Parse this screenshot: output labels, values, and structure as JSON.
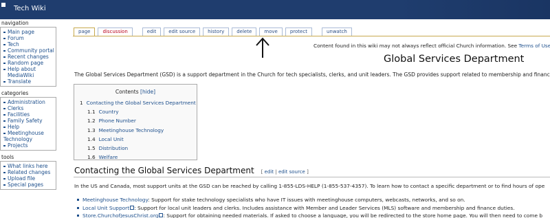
{
  "header": {
    "title": "Tech Wiki"
  },
  "sidebar": {
    "navigation": {
      "title": "navigation",
      "items": [
        "Main page",
        "Forum",
        "Tech",
        "Community portal",
        "Recent changes",
        "Random page",
        "Help about",
        "MediaWiki",
        "Translate"
      ]
    },
    "categories": {
      "title": "categories",
      "items": [
        "Administration",
        "Clerks",
        "Facilities",
        "Family Safety",
        "Help",
        "Meetinghouse",
        "Technology",
        "Projects"
      ]
    },
    "tools": {
      "title": "tools",
      "items": [
        "What links here",
        "Related changes",
        "Upload file",
        "Special pages"
      ]
    }
  },
  "tabs": [
    "page",
    "discussion",
    "edit",
    "edit source",
    "history",
    "delete",
    "move",
    "protect",
    "unwatch"
  ],
  "notice": {
    "text": "Content found in this wiki may not always reflect official Church information. See ",
    "link": "Terms of Use fo"
  },
  "page_title": "Global Services Department",
  "intro": "The Global Services Department (GSD) is a support department in the Church for tech specialists, clerks, and unit leaders. The GSD provides support related to membership and financ",
  "toc": {
    "title": "Contents",
    "hide": "[hide]",
    "items": [
      {
        "num": "1",
        "label": "Contacting the Global Services Department"
      },
      {
        "num": "1.1",
        "label": "Country"
      },
      {
        "num": "1.2",
        "label": "Phone Number"
      },
      {
        "num": "1.3",
        "label": "Meetinghouse Technology"
      },
      {
        "num": "1.4",
        "label": "Local Unit"
      },
      {
        "num": "1.5",
        "label": "Distribution"
      },
      {
        "num": "1.6",
        "label": "Welfare"
      }
    ]
  },
  "section": {
    "heading": "Contacting the Global Services Department",
    "edit_open": "[ ",
    "edit": "edit",
    "sep": " | ",
    "edit_source": "edit source",
    "edit_close": " ]",
    "paragraph": "In the US and Canada, most support units at the GSD can be reached by calling 1-855-LDS-HELP (1-855-537-4357). To learn how to contact a specific department or to find hours of ope"
  },
  "bullets": [
    {
      "link": "Meetinghouse Technology",
      "text": ": Support for stake technology specialists who have IT issues with meetinghouse computers, webcasts, networks, and so on."
    },
    {
      "link": "Local Unit Support",
      "text": ": Support for local unit leaders and clerks. Includes assistance with Member and Leader Services (MLS) software and membership and finance duties."
    },
    {
      "link": "Store.ChurchofJesusChrist.org",
      "text": ": Support for obtaining needed materials. If asked to choose a language, you will be redirected to the store home page. You will then need to come b"
    }
  ]
}
